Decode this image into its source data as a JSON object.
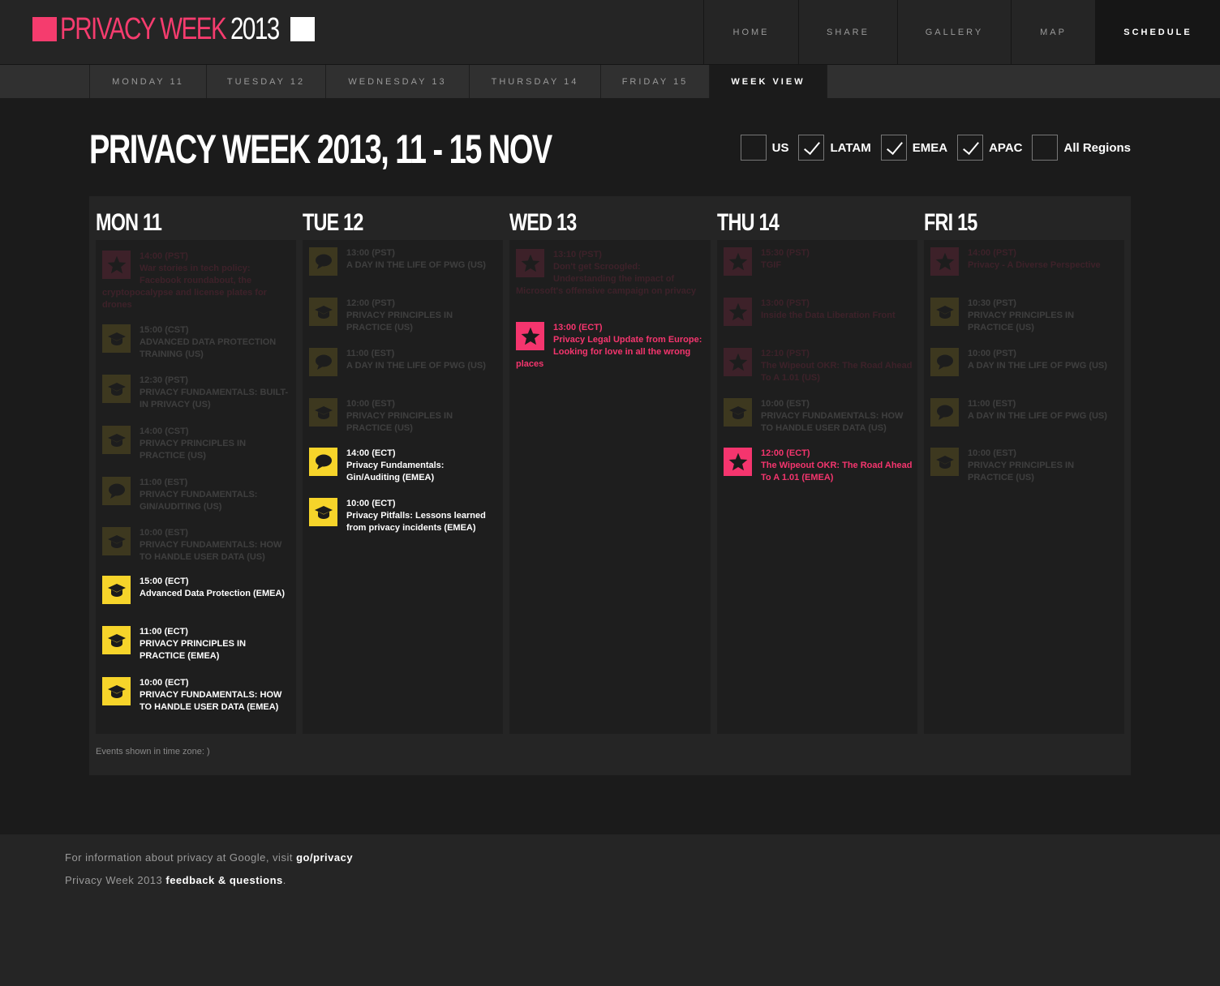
{
  "logo": {
    "part1": "PRIVACY WEEK",
    "part2": "2013"
  },
  "main_nav": [
    {
      "label": "HOME",
      "active": false
    },
    {
      "label": "SHARE",
      "active": false
    },
    {
      "label": "GALLERY",
      "active": false
    },
    {
      "label": "MAP",
      "active": false
    },
    {
      "label": "SCHEDULE",
      "active": true
    }
  ],
  "sub_nav": [
    {
      "label": "MONDAY 11",
      "active": false
    },
    {
      "label": "TUESDAY 12",
      "active": false
    },
    {
      "label": "WEDNESDAY 13",
      "active": false
    },
    {
      "label": "THURSDAY 14",
      "active": false
    },
    {
      "label": "FRIDAY 15",
      "active": false
    },
    {
      "label": "WEEK VIEW",
      "active": true
    }
  ],
  "page_title": "PRIVACY WEEK 2013, 11 - 15 NOV",
  "filters": [
    {
      "label": "US",
      "checked": false
    },
    {
      "label": "LATAM",
      "checked": true
    },
    {
      "label": "EMEA",
      "checked": true
    },
    {
      "label": "APAC",
      "checked": true
    },
    {
      "label": "All Regions",
      "checked": false
    }
  ],
  "days": [
    {
      "label": "MON 11",
      "events": [
        {
          "time": "14:00 (PST)",
          "title": "War stories in tech policy: Facebook roundabout, the cryptopocalypse and license plates for drones",
          "icon": "star",
          "color": "pink",
          "faded": true,
          "inline": true
        },
        {
          "time": "15:00 (CST)",
          "title": "ADVANCED DATA PROTECTION TRAINING (US)",
          "icon": "cap",
          "color": "yellow",
          "faded": true
        },
        {
          "time": "12:30 (PST)",
          "title": "PRIVACY FUNDAMENTALS: BUILT-IN PRIVACY (US)",
          "icon": "cap",
          "color": "yellow",
          "faded": true
        },
        {
          "time": "14:00 (CST)",
          "title": "PRIVACY PRINCIPLES IN PRACTICE (US)",
          "icon": "cap",
          "color": "yellow",
          "faded": true
        },
        {
          "time": "11:00 (EST)",
          "title": "PRIVACY FUNDAMENTALS: GIN/AUDITING (US)",
          "icon": "bubble",
          "color": "yellow",
          "faded": true
        },
        {
          "time": "10:00 (EST)",
          "title": "PRIVACY FUNDAMENTALS: HOW TO HANDLE USER DATA (US)",
          "icon": "cap",
          "color": "yellow",
          "faded": true
        },
        {
          "time": "15:00 (ECT)",
          "title": "Advanced Data Protection (EMEA)",
          "icon": "cap",
          "color": "yellow",
          "faded": false
        },
        {
          "time": "11:00 (ECT)",
          "title": "PRIVACY PRINCIPLES IN PRACTICE (EMEA)",
          "icon": "cap",
          "color": "yellow",
          "faded": false
        },
        {
          "time": "10:00 (ECT)",
          "title": "PRIVACY FUNDAMENTALS: HOW TO HANDLE USER DATA (EMEA)",
          "icon": "cap",
          "color": "yellow",
          "faded": false
        }
      ]
    },
    {
      "label": "TUE 12",
      "events": [
        {
          "time": "13:00 (PST)",
          "title": "A DAY IN THE LIFE OF PWG (US)",
          "icon": "bubble",
          "color": "yellow",
          "faded": true
        },
        {
          "time": "12:00 (PST)",
          "title": "PRIVACY PRINCIPLES IN PRACTICE (US)",
          "icon": "cap",
          "color": "yellow",
          "faded": true
        },
        {
          "time": "11:00 (EST)",
          "title": "A DAY IN THE LIFE OF PWG (US)",
          "icon": "bubble",
          "color": "yellow",
          "faded": true
        },
        {
          "time": "10:00 (EST)",
          "title": "PRIVACY PRINCIPLES IN PRACTICE (US)",
          "icon": "cap",
          "color": "yellow",
          "faded": true
        },
        {
          "time": "14:00 (ECT)",
          "title": "Privacy Fundamentals: Gin/Auditing (EMEA)",
          "icon": "bubble",
          "color": "yellow",
          "faded": false
        },
        {
          "time": "10:00 (ECT)",
          "title": "Privacy Pitfalls: Lessons learned from privacy incidents (EMEA)",
          "icon": "cap",
          "color": "yellow",
          "faded": false
        }
      ]
    },
    {
      "label": "WED 13",
      "events": [
        {
          "time": "13:10 (PST)",
          "title": "Don't get Scroogled: Understanding the impact of Microsoft's offensive campaign on privacy",
          "icon": "star",
          "color": "pink",
          "faded": true,
          "inline": true
        },
        {
          "time": "13:00 (ECT)",
          "title": "Privacy Legal Update from Europe: Looking for love in all the wrong places",
          "icon": "star",
          "color": "pink",
          "faded": false,
          "inline": true
        }
      ]
    },
    {
      "label": "THU 14",
      "events": [
        {
          "time": "15:30 (PST)",
          "title": "TGIF",
          "icon": "star",
          "color": "pink",
          "faded": true
        },
        {
          "time": "13:00 (PST)",
          "title": "Inside the Data Liberation Front",
          "icon": "star",
          "color": "pink",
          "faded": true
        },
        {
          "time": "12:10 (PST)",
          "title": "The Wipeout OKR: The Road Ahead To A 1.01 (US)",
          "icon": "star",
          "color": "pink",
          "faded": true
        },
        {
          "time": "10:00 (EST)",
          "title": "PRIVACY FUNDAMENTALS: HOW TO HANDLE USER DATA (US)",
          "icon": "cap",
          "color": "yellow",
          "faded": true
        },
        {
          "time": "12:00 (ECT)",
          "title": "The Wipeout OKR: The Road Ahead To A 1.01 (EMEA)",
          "icon": "star",
          "color": "pink",
          "faded": false
        }
      ]
    },
    {
      "label": "FRI 15",
      "events": [
        {
          "time": "14:00 (PST)",
          "title": "Privacy - A Diverse Perspective",
          "icon": "star",
          "color": "pink",
          "faded": true
        },
        {
          "time": "10:30 (PST)",
          "title": "PRIVACY PRINCIPLES IN PRACTICE (US)",
          "icon": "cap",
          "color": "yellow",
          "faded": true
        },
        {
          "time": "10:00 (PST)",
          "title": "A DAY IN THE LIFE OF PWG (US)",
          "icon": "bubble",
          "color": "yellow",
          "faded": true
        },
        {
          "time": "11:00 (EST)",
          "title": "A DAY IN THE LIFE OF PWG (US)",
          "icon": "bubble",
          "color": "yellow",
          "faded": true
        },
        {
          "time": "10:00 (EST)",
          "title": "PRIVACY PRINCIPLES IN PRACTICE (US)",
          "icon": "cap",
          "color": "yellow",
          "faded": true
        }
      ]
    }
  ],
  "timezone_note": "Events shown in time zone: )",
  "footer": {
    "line1_prefix": "For information about privacy at Google, visit ",
    "line1_link": "go/privacy",
    "line2_prefix": "Privacy Week 2013 ",
    "line2_link": "feedback & questions",
    "line2_suffix": "."
  },
  "colors": {
    "accent_pink": "#f53c6e",
    "accent_yellow": "#f6d42a"
  }
}
